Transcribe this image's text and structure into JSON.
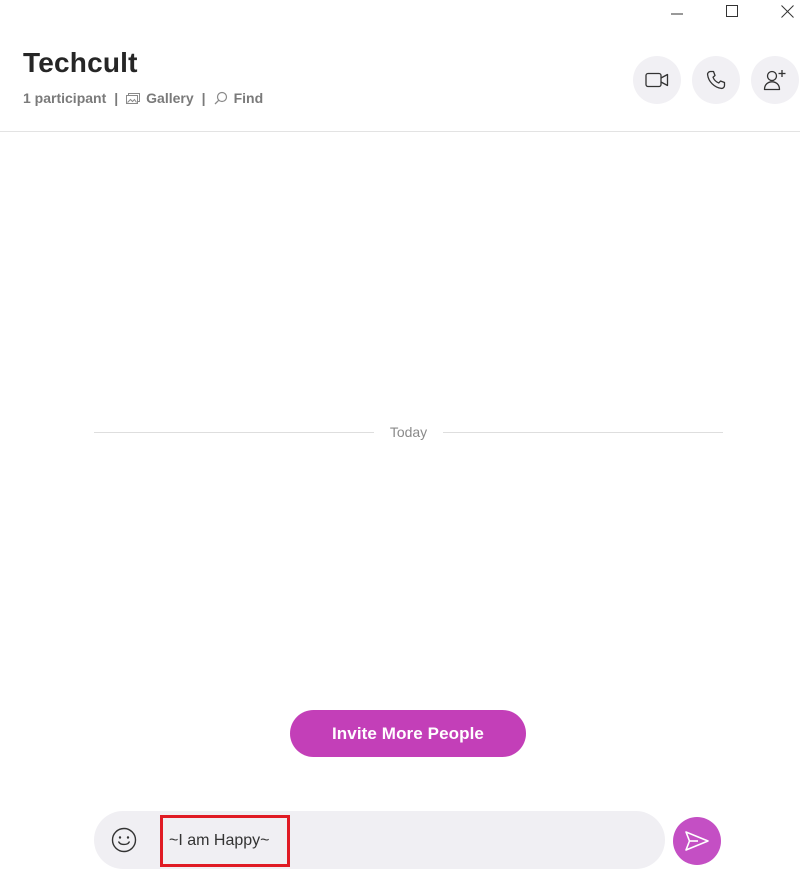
{
  "window": {
    "minimize_icon": "minimize-icon",
    "maximize_icon": "maximize-icon",
    "close_icon": "close-icon"
  },
  "header": {
    "title": "Techcult",
    "participants": "1 participant",
    "separator": "|",
    "gallery_label": "Gallery",
    "find_label": "Find",
    "actions": [
      "video-call-icon",
      "audio-call-icon",
      "add-people-icon"
    ]
  },
  "conversation": {
    "date_divider": "Today"
  },
  "invite_button": {
    "label": "Invite More People"
  },
  "composer": {
    "input_value": "~I am Happy~",
    "emoji_icon": "emoji-icon",
    "send_icon": "send-icon"
  },
  "colors": {
    "accent": "#c33fb8",
    "highlight_box": "#e01b24",
    "button_bg": "#f1f0f4"
  }
}
